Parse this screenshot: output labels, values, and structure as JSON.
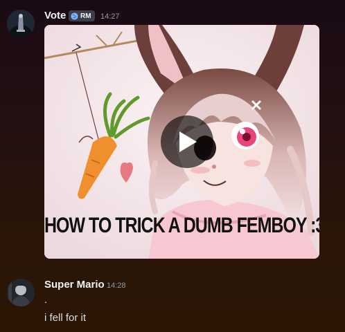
{
  "messages": [
    {
      "author": "Vote",
      "tag": {
        "icon": "globe-icon",
        "label": "RM"
      },
      "time": "14:27",
      "attachment": {
        "type": "video",
        "caption": "HOW TO TRICK A DUMB FEMBOY :3",
        "play_icon": "play-icon"
      }
    },
    {
      "author": "Super Mario",
      "time": "14:28",
      "lines": [
        ".",
        "i fell for it"
      ]
    }
  ]
}
